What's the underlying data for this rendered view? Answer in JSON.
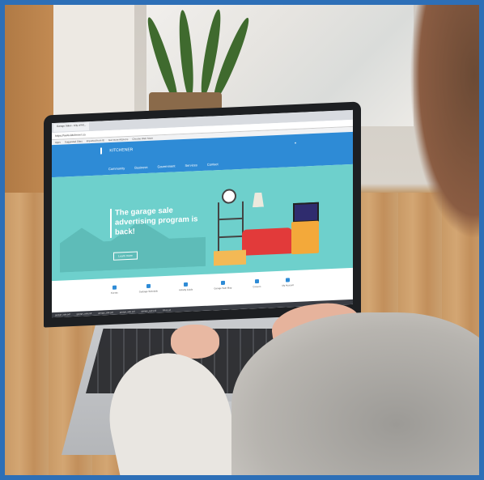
{
  "browser": {
    "tabs": [
      "Garage Sales - City of Kit...",
      "",
      ""
    ],
    "url": "https://www.kitchener.ca",
    "bookmarks": [
      "Apps",
      "Suggested Sites",
      "Imported from IE",
      "Get more Add-ons",
      "Chrome Web Store"
    ]
  },
  "site": {
    "logo_text": "KITCHENER",
    "nav": [
      "Community",
      "Business",
      "Government",
      "Services",
      "Contact"
    ],
    "hero": {
      "title": "The garage sale advertising program is back!",
      "button": "Learn more"
    },
    "quick_links": [
      "Events",
      "Garbage Schedule",
      "Activity Guide",
      "Garage Sale Map",
      "Careers",
      "My Account"
    ],
    "downloads_bar": [
      "garage_sale.pdf",
      "garage_sale.pdf",
      "garage_sale.pdf",
      "garage_sale.pdf",
      "garage_sale.pdf",
      "Show all"
    ]
  },
  "colors": {
    "frame_border": "#2d6fb7",
    "site_header": "#2e8bd6",
    "hero_bg": "#6ed0cc",
    "sofa": "#e23a3a",
    "dresser": "#f3a93a"
  }
}
